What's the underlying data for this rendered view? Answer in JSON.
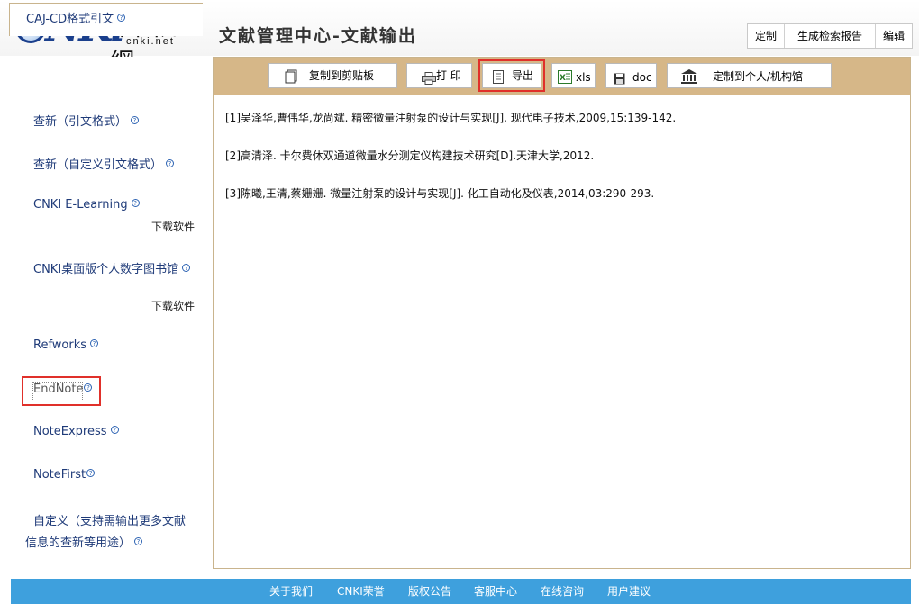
{
  "header": {
    "logo_text": "CNKI",
    "logo_cn": "中國知網",
    "logo_net": "cnki.net",
    "title": "文献管理中心-文献输出",
    "actions": [
      "定制",
      "生成检索报告",
      "编辑"
    ]
  },
  "sidebar": {
    "tab": "CAJ-CD格式引文",
    "items": [
      {
        "label": "查新（引文格式）"
      },
      {
        "label": "查新（自定义引文格式）"
      },
      {
        "label": "CNKI E-Learning",
        "download": "下载软件"
      },
      {
        "label": "CNKI桌面版个人数字图书馆",
        "download": "下载软件"
      },
      {
        "label": "Refworks"
      },
      {
        "label": "EndNote"
      },
      {
        "label": "NoteExpress"
      },
      {
        "label": "NoteFirst"
      },
      {
        "label": "自定义（支持需输出更多文献",
        "label2": "信息的查新等用途）"
      }
    ],
    "help_glyph": "?"
  },
  "toolbar": {
    "copy": "复制到剪贴板",
    "print": "打 印",
    "export": "导出",
    "xls": "xls",
    "doc": "doc",
    "custom": "定制到个人/机构馆"
  },
  "references": [
    "[1]吴泽华,曹伟华,龙尚斌. 精密微量注射泵的设计与实现[J]. 现代电子技术,2009,15:139-142.",
    "[2]高清泽. 卡尔费休双通道微量水分测定仪构建技术研究[D].天津大学,2012.",
    "[3]陈曦,王清,蔡姗姗. 微量注射泵的设计与实现[J]. 化工自动化及仪表,2014,03:290-293."
  ],
  "footer": [
    "关于我们",
    "CNKI荣誉",
    "版权公告",
    "客服中心",
    "在线咨询",
    "用户建议"
  ],
  "colors": {
    "toolbar_bg": "#d6b788",
    "footer_bg": "#3ea0dd",
    "link": "#1e3a78",
    "highlight": "#e0302a"
  }
}
